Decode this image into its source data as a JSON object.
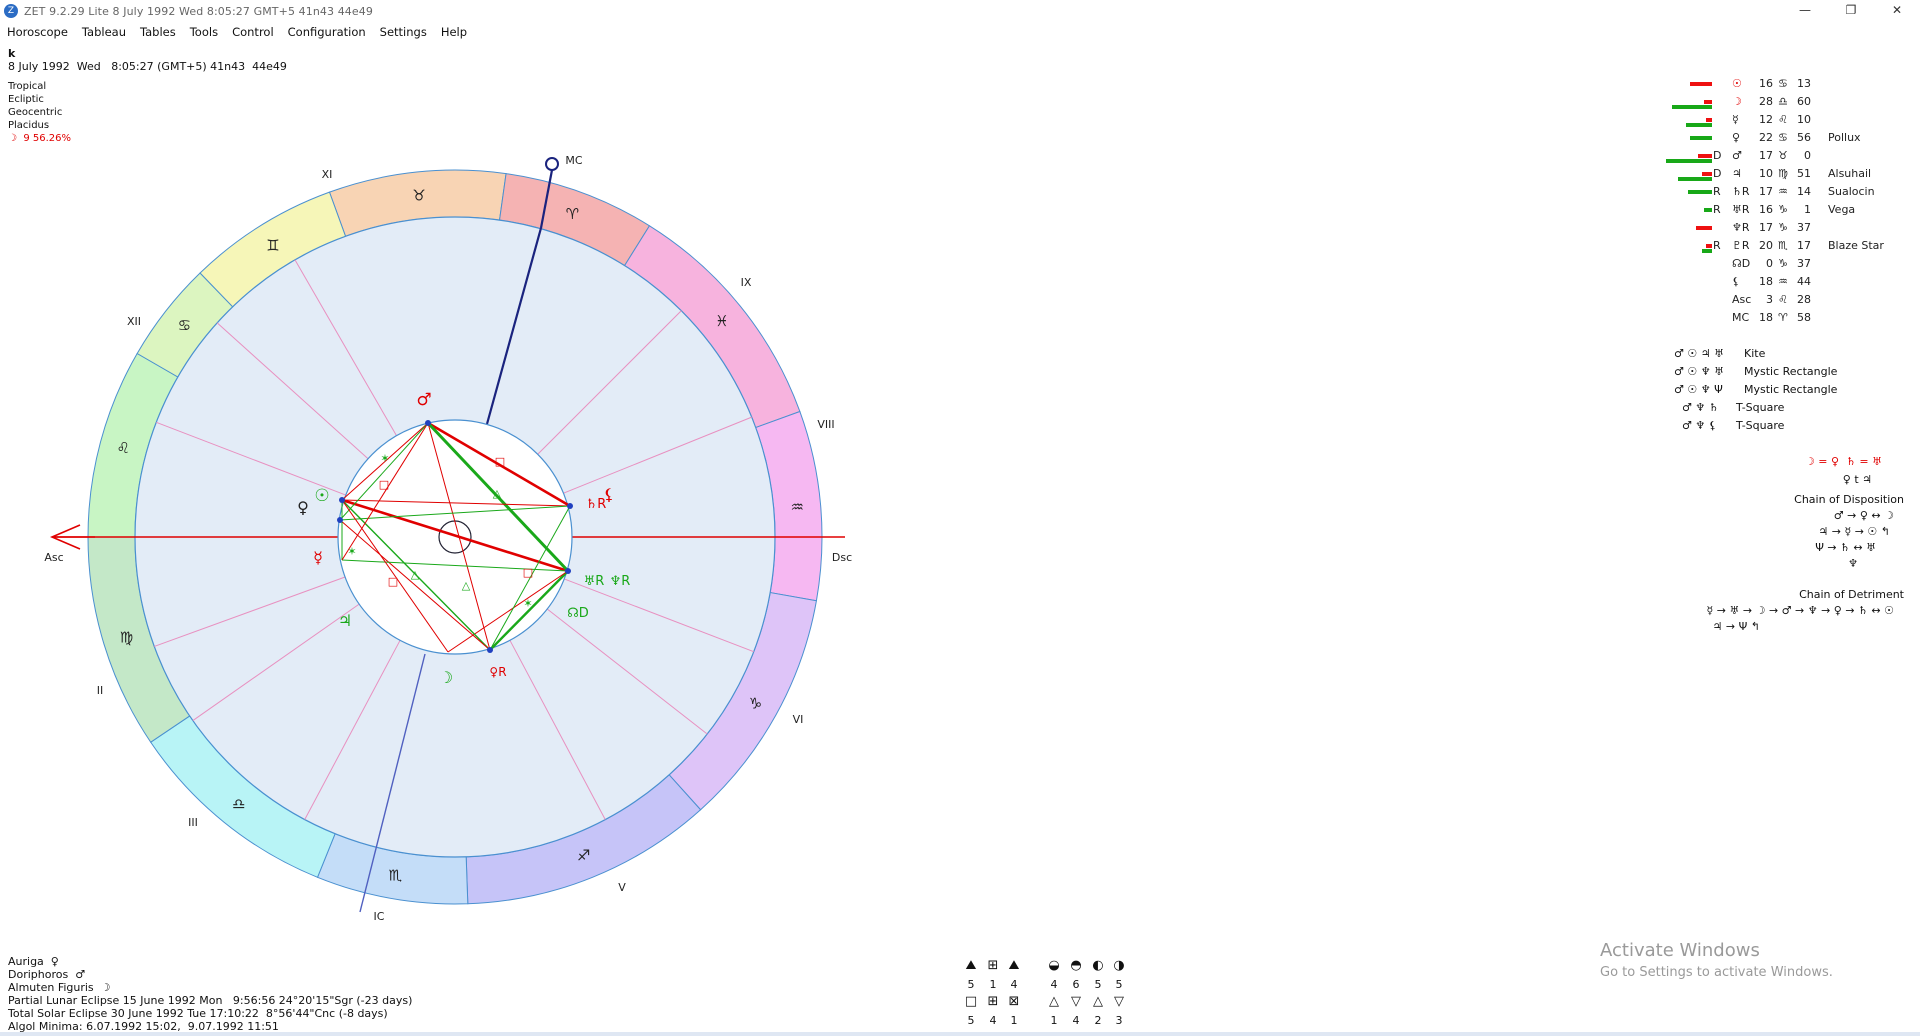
{
  "window": {
    "title": "ZET 9.2.29 Lite    8 July 1992   Wed   8:05:27 GMT+5 41n43  44e49",
    "icon": "zet-app-icon",
    "controls": {
      "minimize": "—",
      "restore": "❐",
      "close": "✕"
    }
  },
  "menu": [
    "Horoscope",
    "Tableau",
    "Tables",
    "Tools",
    "Control",
    "Configuration",
    "Settings",
    "Help"
  ],
  "chart_info": {
    "name": "k",
    "datetime": "8 July 1992  Wed   8:05:27 (GMT+5) 41n43  44e49",
    "zodiac": "Tropical",
    "coords": "Ecliptic",
    "center": "Geocentric",
    "houses": "Placidus",
    "moon_phase": "☽  9 56.26%"
  },
  "wheel": {
    "house_labels": [
      "XI",
      "MC",
      "IX",
      "XII",
      "VIII",
      "Asc",
      "Dsc",
      "II",
      "VI",
      "III",
      "V",
      "IC"
    ],
    "signs": [
      "♉",
      "♈",
      "♓",
      "♊",
      "♋",
      "♒",
      "♌",
      "♑",
      "♍",
      "♐",
      "♎",
      "♏"
    ],
    "sign_colors": [
      "#f8d4b4",
      "#f5b3b3",
      "#f7b3de",
      "#f6f6b8",
      "#dcf5c0",
      "#f6b8f2",
      "#c8f5c4",
      "#dec4f8",
      "#c4e8c8",
      "#c6c4f8",
      "#b8f4f6",
      "#c4ddf8"
    ],
    "planets_on_wheel": {
      "mars": "♂",
      "venus": "♀",
      "sun": "☉",
      "mercury": "☿",
      "jupiter": "♃",
      "moon": "☽",
      "pluto": "♀R",
      "saturn": "♄R",
      "lilith": "⚸",
      "uranus": "♅R",
      "neptune": "♆R",
      "node": "☊D"
    }
  },
  "positions": [
    {
      "glyph": "☉",
      "color": "red",
      "flag": "",
      "deg": "16",
      "sign": "♋",
      "min": "13",
      "star": ""
    },
    {
      "glyph": "☽",
      "color": "red",
      "flag": "",
      "deg": "28",
      "sign": "♎",
      "min": "60",
      "star": ""
    },
    {
      "glyph": "☿",
      "color": "black",
      "flag": "",
      "deg": "12",
      "sign": "♌",
      "min": "10",
      "star": ""
    },
    {
      "glyph": "♀",
      "color": "black",
      "flag": "",
      "deg": "22",
      "sign": "♋",
      "min": "56",
      "star": "Pollux"
    },
    {
      "glyph": "♂",
      "color": "black",
      "flag": "D",
      "deg": "17",
      "sign": "♉",
      "min": "0",
      "star": ""
    },
    {
      "glyph": "♃",
      "color": "black",
      "flag": "D",
      "deg": "10",
      "sign": "♍",
      "min": "51",
      "star": "Alsuhail"
    },
    {
      "glyph": "♄R",
      "color": "black",
      "flag": "R",
      "deg": "17",
      "sign": "♒",
      "min": "14",
      "star": "Sualocin"
    },
    {
      "glyph": "♅R",
      "color": "black",
      "flag": "R",
      "deg": "16",
      "sign": "♑",
      "min": "1",
      "star": "Vega"
    },
    {
      "glyph": "♆R",
      "color": "black",
      "flag": "",
      "deg": "17",
      "sign": "♑",
      "min": "37",
      "star": ""
    },
    {
      "glyph": "♇R",
      "color": "black",
      "flag": "R",
      "deg": "20",
      "sign": "♏",
      "min": "17",
      "star": "Blaze Star"
    },
    {
      "glyph": "☊D",
      "color": "black",
      "flag": "",
      "deg": "0",
      "sign": "♑",
      "min": "37",
      "star": ""
    },
    {
      "glyph": "⚸",
      "color": "black",
      "flag": "",
      "deg": "18",
      "sign": "♒",
      "min": "44",
      "star": ""
    },
    {
      "glyph": "Asc",
      "color": "black",
      "flag": "",
      "deg": "3",
      "sign": "♌",
      "min": "28",
      "star": ""
    },
    {
      "glyph": "MC",
      "color": "black",
      "flag": "",
      "deg": "18",
      "sign": "♈",
      "min": "58",
      "star": ""
    }
  ],
  "strength_bars": [
    {
      "red": 22,
      "green": 0
    },
    {
      "red": 8,
      "green": 40
    },
    {
      "red": 6,
      "green": 26
    },
    {
      "red": 0,
      "green": 22
    },
    {
      "red": 14,
      "green": 46
    },
    {
      "red": 10,
      "green": 34
    },
    {
      "red": 0,
      "green": 24
    },
    {
      "red": 0,
      "green": 8
    },
    {
      "red": 16,
      "green": 0
    },
    {
      "red": 6,
      "green": 10
    }
  ],
  "configurations": [
    {
      "glyphs": "♂ ☉ ♃ ♅",
      "name": "Kite"
    },
    {
      "glyphs": "♂ ☉ ♆ ♅",
      "name": "Mystic Rectangle"
    },
    {
      "glyphs": "♂ ☉ ♆ Ψ",
      "name": "Mystic Rectangle"
    },
    {
      "glyphs": "♂ ♆ ♄",
      "name": "T-Square"
    },
    {
      "glyphs": "♂ ♆ ⚸",
      "name": "T-Square"
    }
  ],
  "dispositions": {
    "top1": "☽ = ♀  ♄ = ♅",
    "top2": "♀ t ♃",
    "chain_title": "Chain of Disposition",
    "chain_lines": [
      "♂ → ♀ ↔ ☽",
      "♃ → ☿ → ☉ ↰",
      "Ψ → ♄ ↔ ♅",
      "♆"
    ],
    "detriment_title": "Chain of Detriment",
    "detriment_lines": [
      "☿ → ♅ → ☽ → ♂ → ♆ → ♀ → ♄ ↔ ☉",
      "♃ → Ψ ↰"
    ]
  },
  "bottom_info": [
    "Auriga  ♀",
    "Doriphoros  ♂",
    "Almuten Figuris  ☽",
    "Partial Lunar Eclipse 15 June 1992 Mon   9:56:56 24°20'15\"Sgr (-23 days)",
    "Total Solar Eclipse 30 June 1992 Tue 17:10:22  8°56'44\"Cnc (-8 days)",
    "Algol Minima: 6.07.1992 15:02,  9.07.1992 11:51"
  ],
  "modality_counts": {
    "row1_icons": [
      "⛰",
      "⊞",
      "⛰",
      "",
      "◒",
      "◓",
      "◐",
      "◑"
    ],
    "row1_vals": [
      "5",
      "1",
      "4",
      "",
      "4",
      "6",
      "5",
      "5"
    ],
    "row2_icons": [
      "□",
      "⊞",
      "⊠",
      "",
      "△",
      "▽",
      "△",
      "▽"
    ],
    "row2_vals": [
      "5",
      "4",
      "1",
      "",
      "1",
      "4",
      "2",
      "3"
    ]
  },
  "watermark": {
    "line1": "Activate Windows",
    "line2": "Go to Settings to activate Windows."
  }
}
